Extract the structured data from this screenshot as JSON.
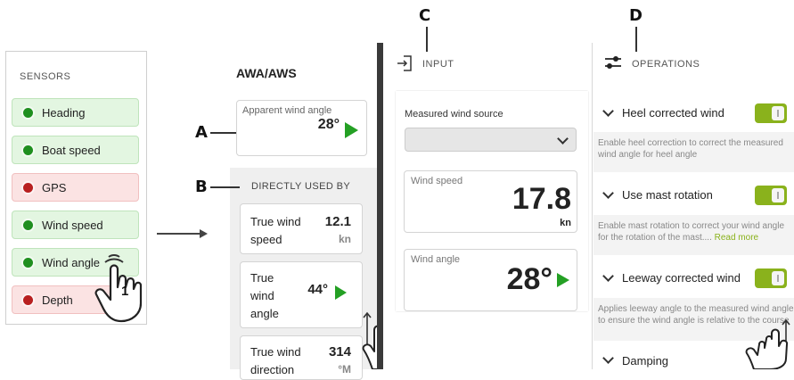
{
  "sensors": {
    "title": "SENSORS",
    "items": [
      {
        "label": "Heading",
        "status": "ok"
      },
      {
        "label": "Boat speed",
        "status": "ok"
      },
      {
        "label": "GPS",
        "status": "error"
      },
      {
        "label": "Wind speed",
        "status": "ok"
      },
      {
        "label": "Wind angle",
        "status": "ok"
      },
      {
        "label": "Depth",
        "status": "error"
      }
    ]
  },
  "awa": {
    "title": "AWA/AWS",
    "apparent": {
      "label": "Apparent wind angle",
      "value": "28°"
    },
    "used_by": {
      "title": "DIRECTLY USED BY",
      "items": [
        {
          "name": "True wind speed",
          "value": "12.1",
          "unit": "kn"
        },
        {
          "name": "True wind angle",
          "value": "44°",
          "unit": ""
        },
        {
          "name": "True wind direction",
          "value": "314",
          "unit": "°M"
        }
      ]
    }
  },
  "input": {
    "header": "INPUT",
    "measured_source_label": "Measured wind source",
    "selected_source": "",
    "wind_speed": {
      "label": "Wind speed",
      "value": "17.8",
      "unit": "kn"
    },
    "wind_angle": {
      "label": "Wind angle",
      "value": "28°"
    }
  },
  "operations": {
    "header": "OPERATIONS",
    "items": [
      {
        "title": "Heel corrected wind",
        "enabled": true,
        "description": "Enable heel correction to correct the measured wind angle for heel angle",
        "read_more": ""
      },
      {
        "title": "Use mast rotation",
        "enabled": true,
        "description": "Enable mast rotation to correct your wind angle for the rotation of the mast....",
        "read_more": "Read more"
      },
      {
        "title": "Leeway corrected wind",
        "enabled": true,
        "description": "Applies leeway angle to the measured wind angle to ensure the wind angle is relative to the course",
        "read_more": ""
      },
      {
        "title": "Damping",
        "enabled": null,
        "description": "",
        "read_more": ""
      }
    ]
  },
  "annotations": {
    "a": "A",
    "b": "B",
    "c": "C",
    "d": "D",
    "step": "1"
  },
  "colors": {
    "accent_green": "#8ab21c",
    "ok_green": "#1f8f1f",
    "error_red": "#b82020",
    "play_green": "#24a024"
  }
}
